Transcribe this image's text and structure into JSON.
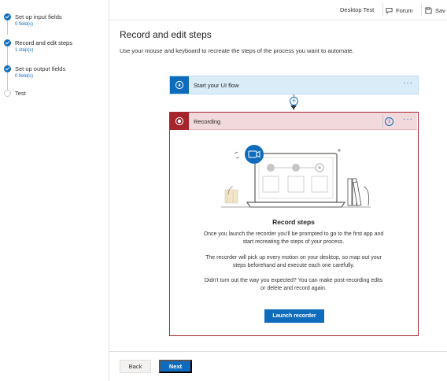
{
  "sidebar": {
    "steps": [
      {
        "title": "Set up input fields",
        "sub": "0 field(s)",
        "status": "done"
      },
      {
        "title": "Record and edit steps",
        "sub": "1 step(s)",
        "status": "done"
      },
      {
        "title": "Set up output fields",
        "sub": "0 field(s)",
        "status": "done"
      },
      {
        "title": "Test",
        "sub": "",
        "status": "todo"
      }
    ]
  },
  "topbar": {
    "flow_name": "Desktop Test",
    "forum_label": "Forum",
    "save_label": "Sav"
  },
  "main": {
    "title": "Record and edit steps",
    "subtitle": "Use your mouse and keyboard to recreate the steps of the process you want to automate.",
    "start_card": {
      "label": "Start your UI flow",
      "more": "···"
    },
    "recording_card": {
      "label": "Recording",
      "info": "i",
      "more": "···",
      "heading": "Record steps",
      "para1": "Once you launch the recorder you'll be prompted to go to the first app and start recreating the steps of your process.",
      "para2": "The recorder will pick up every motion on your desktop, so map out your steps beforehand and execute each one carefully.",
      "para3": "Didn't turn out the way you expected? You can make post-recording edits or delete and record again.",
      "launch_label": "Launch recorder"
    }
  },
  "footer": {
    "back_label": "Back",
    "next_label": "Next"
  },
  "colors": {
    "accent": "#0f6cbd",
    "record_red": "#a4262c",
    "start_bg": "#d9ecf8",
    "record_bg": "#f2d9db"
  }
}
